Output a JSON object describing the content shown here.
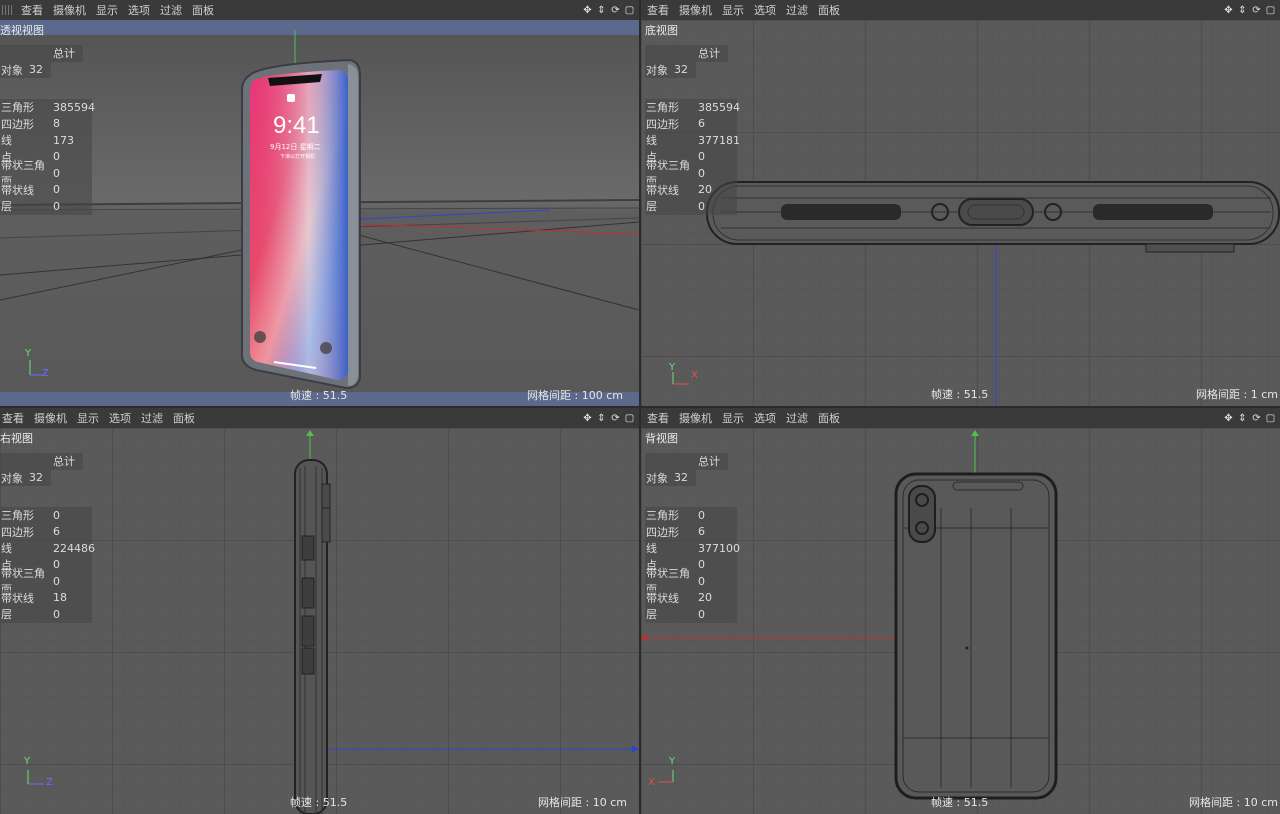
{
  "menu": [
    "查看",
    "摄像机",
    "显示",
    "选项",
    "过滤",
    "面板"
  ],
  "stat_labels": {
    "total": "总计",
    "objects": "对象",
    "triangles": "三角形",
    "quads": "四边形",
    "lines": "线",
    "points": "点",
    "strip_tris": "带状三角面",
    "strip_lines": "带状线",
    "layers": "层"
  },
  "viewports": {
    "perspective": {
      "title": "透视视图",
      "objects": "32",
      "triangles": "385594",
      "quads": "8",
      "lines": "173",
      "points": "0",
      "strip_tris": "0",
      "strip_lines": "0",
      "layers": "0",
      "fps": "帧速 : 51.5",
      "grid": "网格间距 : 100 cm",
      "axes": [
        "Y",
        "Z"
      ],
      "phone_time": "9:41",
      "phone_date": "9月12日 星期二",
      "phone_sub": "下滑以打开相机"
    },
    "bottom": {
      "title": "底视图",
      "objects": "32",
      "triangles": "385594",
      "quads": "6",
      "lines": "377181",
      "points": "0",
      "strip_tris": "0",
      "strip_lines": "20",
      "layers": "0",
      "fps": "帧速 : 51.5",
      "grid": "网格间距 : 1 cm",
      "axes": [
        "Y",
        "X"
      ]
    },
    "right": {
      "title": "右视图",
      "objects": "32",
      "triangles": "0",
      "quads": "6",
      "lines": "224486",
      "points": "0",
      "strip_tris": "0",
      "strip_lines": "18",
      "layers": "0",
      "fps": "帧速 : 51.5",
      "grid": "网格间距 : 10 cm",
      "axes": [
        "Y",
        "Z"
      ]
    },
    "back": {
      "title": "背视图",
      "objects": "32",
      "triangles": "0",
      "quads": "6",
      "lines": "377100",
      "points": "0",
      "strip_tris": "0",
      "strip_lines": "20",
      "layers": "0",
      "fps": "帧速 : 51.5",
      "grid": "网格间距 : 10 cm",
      "axes": [
        "Y",
        "X"
      ]
    }
  },
  "colors": {
    "axis_y": "#6ee06e",
    "axis_x": "#e05050",
    "axis_z": "#6070ff",
    "title_bar": "#5b6a8c"
  },
  "icons": [
    "move-icon",
    "zoom-icon",
    "rotate-icon",
    "maximize-icon"
  ]
}
